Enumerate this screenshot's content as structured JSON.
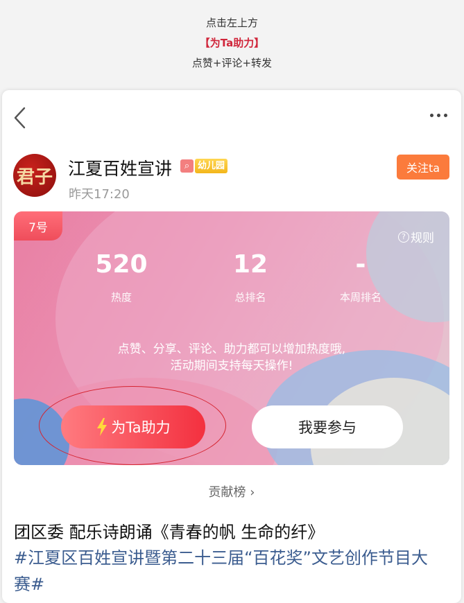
{
  "top_hint": {
    "line1": "点击左上方",
    "line2": "【为Ta助力】",
    "line3": "点赞+评论+转发"
  },
  "header": {
    "back_icon": "chevron-left-icon",
    "more_icon": "more-dots-icon"
  },
  "author": {
    "avatar_text": "君子",
    "name": "江夏百姓宣讲",
    "badge_search_icon": "search-icon",
    "badge_level": "幼儿园",
    "time": "昨天17:20",
    "follow_label": "关注ta"
  },
  "banner": {
    "rank_tag": "7号",
    "rules_label": "规则",
    "stats": [
      {
        "value": "520",
        "label": "热度"
      },
      {
        "value": "12",
        "label": "总排名"
      },
      {
        "value": "-",
        "label": "本周排名"
      }
    ],
    "message_line1": "点赞、分享、评论、助力都可以增加热度哦,",
    "message_line2": "活动期间支持每天操作!",
    "boost_label": "为Ta助力",
    "join_label": "我要参与",
    "colors": {
      "boost": "#f3303f",
      "rank_tag": "#ef4d5b"
    }
  },
  "contrib": {
    "label": "贡献榜 ›"
  },
  "post": {
    "title": "团区委 配乐诗朗诵《青春的帆 生命的纤》",
    "tag": "#江夏区百姓宣讲暨第二十三届“百花奖”文艺创作节目大赛#"
  }
}
